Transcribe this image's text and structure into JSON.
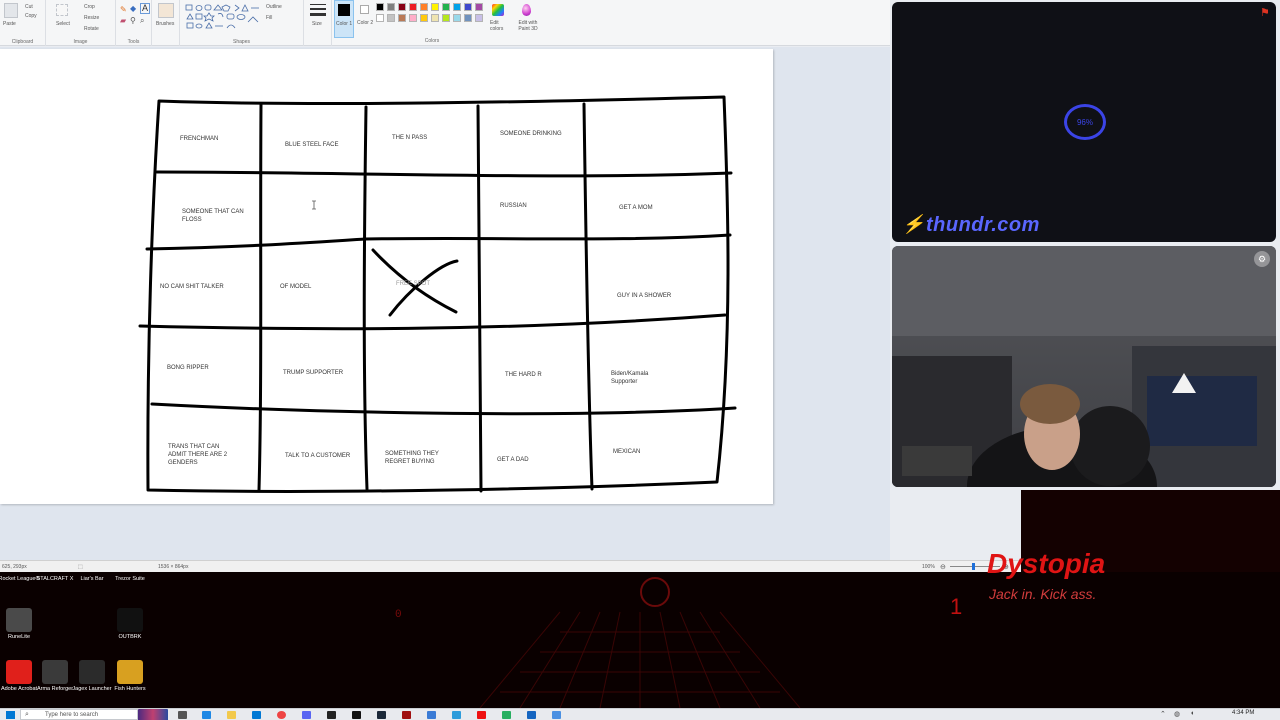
{
  "ribbon": {
    "clipboard": {
      "paste_label": "Paste",
      "cut_label": "Cut",
      "copy_label": "Copy",
      "group_label": "Clipboard"
    },
    "image": {
      "select_label": "Select",
      "crop_label": "Crop",
      "resize_label": "Resize",
      "rotate_label": "Rotate",
      "group_label": "Image"
    },
    "tools": {
      "group_label": "Tools"
    },
    "brushes": {
      "label": "Brushes"
    },
    "shapes": {
      "outline_label": "Outline",
      "fill_label": "Fill",
      "group_label": "Shapes"
    },
    "size_label": "Size",
    "color1_label": "Color 1",
    "color2_label": "Color 2",
    "colors_group_label": "Colors",
    "edit_colors_label": "Edit colors",
    "edit_paint3d_label": "Edit with Paint 3D",
    "palette": [
      "#000000",
      "#7f7f7f",
      "#880015",
      "#ed1c24",
      "#ff7f27",
      "#fff200",
      "#22b14c",
      "#00a2e8",
      "#3f48cc",
      "#a349a4",
      "#ffffff",
      "#c3c3c3",
      "#b97a57",
      "#ffaec9",
      "#ffc90e",
      "#efe4b0",
      "#b5e61d",
      "#99d9ea",
      "#7092be",
      "#c8bfe7"
    ]
  },
  "bingo": {
    "cells": [
      [
        "FRENCHMAN",
        "BLUE STEEL FACE",
        "THE N PASS",
        "SOMEONE DRINKING",
        ""
      ],
      [
        "SOMEONE THAT CAN FLOSS",
        "",
        "",
        "RUSSIAN",
        "GET A MOM"
      ],
      [
        "NO CAM SHIT TALKER",
        "OF MODEL",
        "FREE SPOT",
        "",
        "GUY IN A SHOWER"
      ],
      [
        "BONG RIPPER",
        "TRUMP SUPPORTER",
        "",
        "THE HARD R",
        "Biden/Kamala Supporter"
      ],
      [
        "TRANS THAT CAN ADMIT THERE ARE 2 GENDERS",
        "TALK TO A CUSTOMER",
        "SOMETHING THEY REGRET BUYING",
        "GET A DAD",
        "MEXICAN"
      ]
    ]
  },
  "statusbar": {
    "cursor_pos": "625, 293px",
    "canvas_size": "1536 × 864px",
    "zoom": "100%"
  },
  "thundr": {
    "logo_text": "thundr.com",
    "loading_percent": "96%"
  },
  "desktop": {
    "icons": [
      {
        "label": "Rocket League®",
        "color": "#2a4fa8"
      },
      {
        "label": "STALCRAFT X",
        "color": "#333333"
      },
      {
        "label": "Liar's Bar",
        "color": "#5a3a1a"
      },
      {
        "label": "Trezor Suite",
        "color": "#222222"
      },
      {
        "label": "RuneLite",
        "color": "#4a4a4a"
      },
      {
        "label": "OUTBRK",
        "color": "#111111"
      },
      {
        "label": "Adobe Acrobat",
        "color": "#e0201b"
      },
      {
        "label": "Arma Reforger",
        "color": "#3a3a3a"
      },
      {
        "label": "Jagex Launcher",
        "color": "#2b2b2b"
      },
      {
        "label": "Fish Hunters",
        "color": "#d8a020"
      }
    ],
    "banner_title": "Dystopia",
    "banner_tagline": "Jack in. Kick ass."
  },
  "taskbar": {
    "search_placeholder": "Type here to search",
    "time": "4:34 PM"
  },
  "colors": {
    "accent_red": "#d20f0f",
    "thundr_blue": "#3b44e6"
  }
}
